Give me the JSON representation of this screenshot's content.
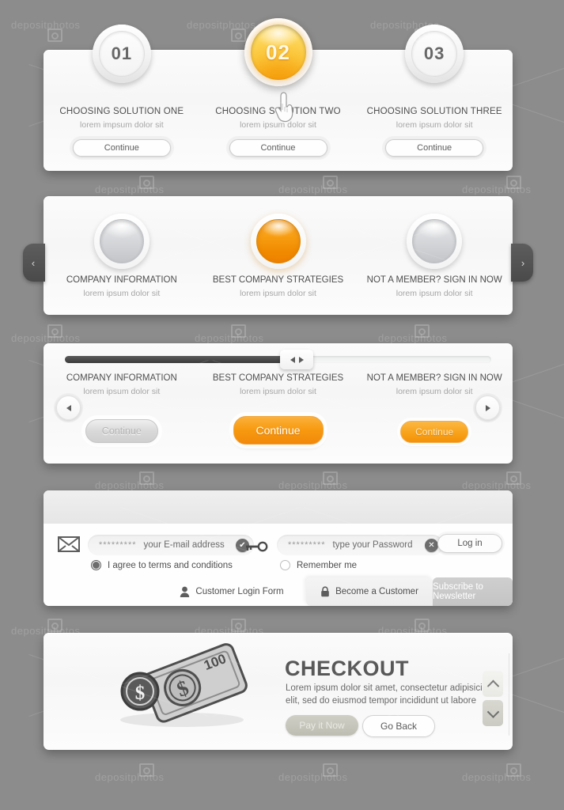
{
  "steps_panel": {
    "items": [
      {
        "number": "01",
        "title": "CHOOSING SOLUTION ONE",
        "subtitle": "lorem impsum dolor sit",
        "button": "Continue",
        "state": "default"
      },
      {
        "number": "02",
        "title": "CHOOSING SOLUTION TWO",
        "subtitle": "lorem ipsum dolor sit",
        "button": "Continue",
        "state": "active"
      },
      {
        "number": "03",
        "title": "CHOOSING SOLUTION THREE",
        "subtitle": "lorem ipsum dolor sit",
        "button": "Continue",
        "state": "default"
      }
    ],
    "cursor_icon": "hand-pointer-icon"
  },
  "spheres_panel": {
    "prev_arrow": "‹",
    "next_arrow": "›",
    "items": [
      {
        "title": "COMPANY INFORMATION",
        "subtitle": "lorem ipsum dolor sit",
        "color": "silver"
      },
      {
        "title": "BEST COMPANY STRATEGIES",
        "subtitle": "lorem ipsum dolor sit",
        "color": "orange"
      },
      {
        "title": "NOT A MEMBER? SIGN IN NOW",
        "subtitle": "lorem ipsum dolor sit",
        "color": "silver"
      }
    ]
  },
  "slider_panel": {
    "progress_percent": 53,
    "items": [
      {
        "title": "COMPANY INFORMATION",
        "subtitle": "lorem ipsum dolor sit",
        "button": "Continue",
        "style": "grey"
      },
      {
        "title": "BEST COMPANY STRATEGIES",
        "subtitle": "lorem ipsum dolor sit",
        "button": "Continue",
        "style": "orange-large"
      },
      {
        "title": "NOT A MEMBER? SIGN IN NOW",
        "subtitle": "lorem ipsum dolor sit",
        "button": "Continue",
        "style": "orange-small"
      }
    ]
  },
  "login_panel": {
    "email": {
      "icon": "envelope-icon",
      "stars": "*********",
      "placeholder": "your E-mail address",
      "status": "✔",
      "status_name": "valid"
    },
    "password": {
      "icon": "key-icon",
      "stars": "*********",
      "placeholder": "type your Password",
      "status": "✕",
      "status_name": "invalid"
    },
    "login_button": "Log in",
    "terms": {
      "label": "I agree to terms and conditions",
      "checked": true
    },
    "remember": {
      "label": "Remember me",
      "checked": false
    },
    "tabs": [
      {
        "label": "Customer Login Form",
        "icon": "user-icon",
        "state": "active"
      },
      {
        "label": "Become a Customer",
        "icon": "lock-icon",
        "state": "inactive"
      },
      {
        "label": "Subscribe to Newsletter",
        "icon": "",
        "state": "inactive-dark"
      }
    ]
  },
  "checkout_panel": {
    "icon": "money-icon",
    "bill_value": "100",
    "title": "CHECKOUT",
    "text": "Lorem ipsum dolor sit amet, consectetur adipisicing elit, sed do eiusmod tempor incididunt ut labore",
    "pay_button": "Pay it Now",
    "back_button": "Go Back",
    "scroll_up": "chevron-up-icon",
    "scroll_down": "chevron-down-icon"
  },
  "colors": {
    "background": "#8c8c8c",
    "panel": "#fafafa",
    "accent_orange": "#f79a10",
    "text_dark": "#4e4e4e",
    "text_muted": "#a6a6a6"
  },
  "watermark": {
    "text": "depositphotos"
  }
}
